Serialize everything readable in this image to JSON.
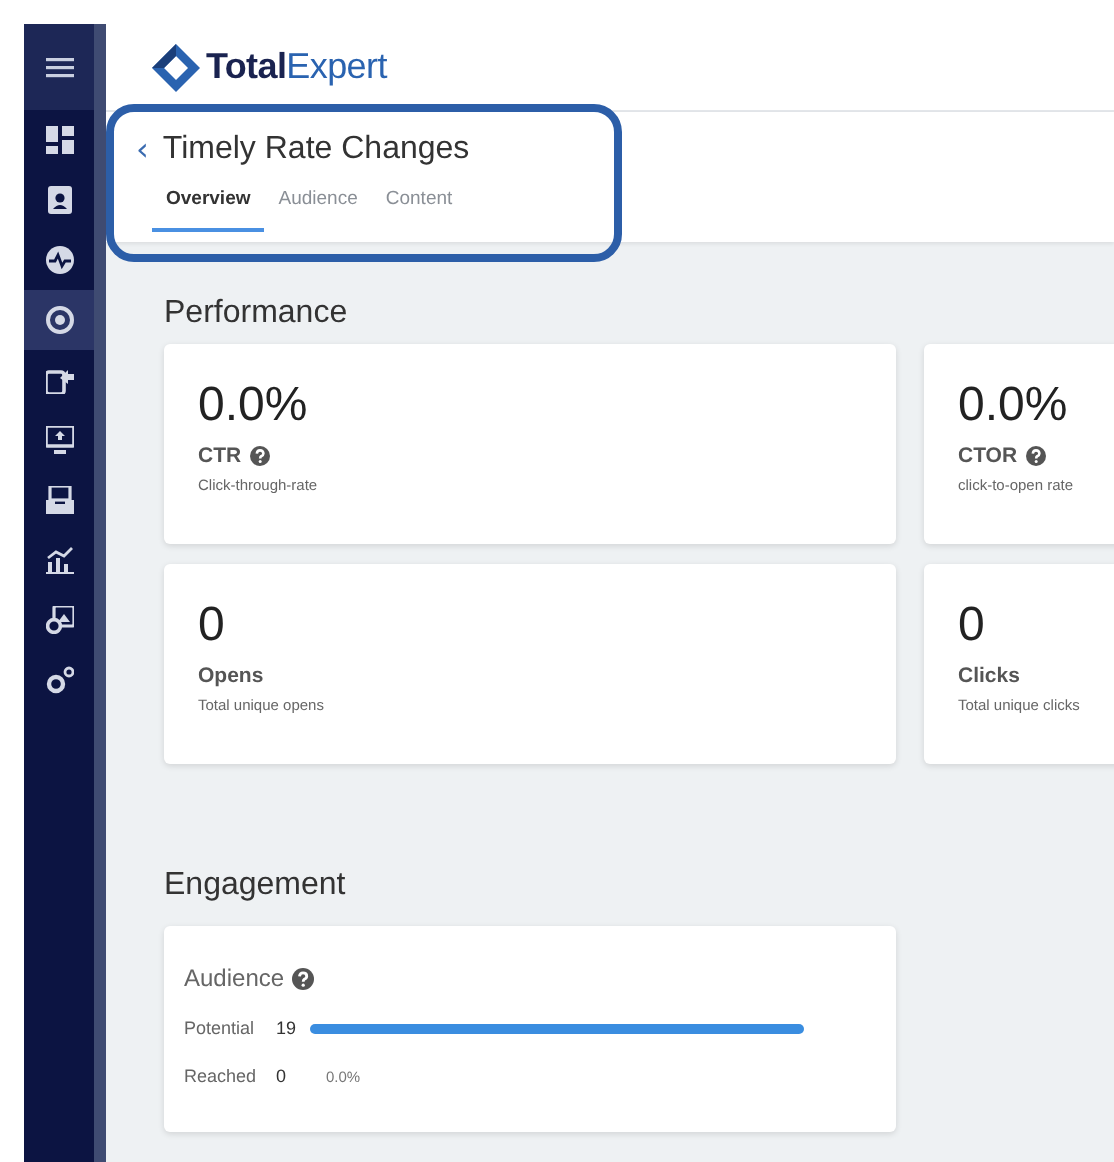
{
  "sidebar": {
    "items": [
      {
        "selected": false
      },
      {
        "selected": false
      },
      {
        "selected": false
      },
      {
        "selected": true
      },
      {
        "selected": false
      },
      {
        "selected": false
      },
      {
        "selected": false
      },
      {
        "selected": false
      },
      {
        "selected": false
      },
      {
        "selected": false
      }
    ]
  },
  "header": {
    "logo": "**Total**Expert"
  },
  "page": {
    "back": "‹",
    "title": "Timely Rate Changes",
    "tabs": [
      {
        "label": "Overview",
        "selected": true
      },
      {
        "label": "Audience",
        "selected": false
      },
      {
        "label": "Content",
        "selected": false
      }
    ]
  },
  "performance": {
    "heading": "Performance",
    "metrics": [
      {
        "value": "0.0%",
        "label": "CTR",
        "help": true,
        "description": "Click-through-rate"
      },
      {
        "value": "0.0%",
        "label": "CTOR",
        "help": true,
        "description": "click-to-open rate"
      },
      {
        "value": "0",
        "label": "Opens",
        "help": false,
        "description": "Total unique opens"
      },
      {
        "value": "0",
        "label": "Clicks",
        "help": false,
        "description": "Total unique clicks"
      }
    ]
  },
  "engagement": {
    "heading": "Engagement",
    "card_title": "Audience",
    "help": true,
    "rows": [
      {
        "label": "Potential",
        "count": "19"
      },
      {
        "label": "Reached",
        "count": "0",
        "percent": "0.0%"
      }
    ]
  }
}
